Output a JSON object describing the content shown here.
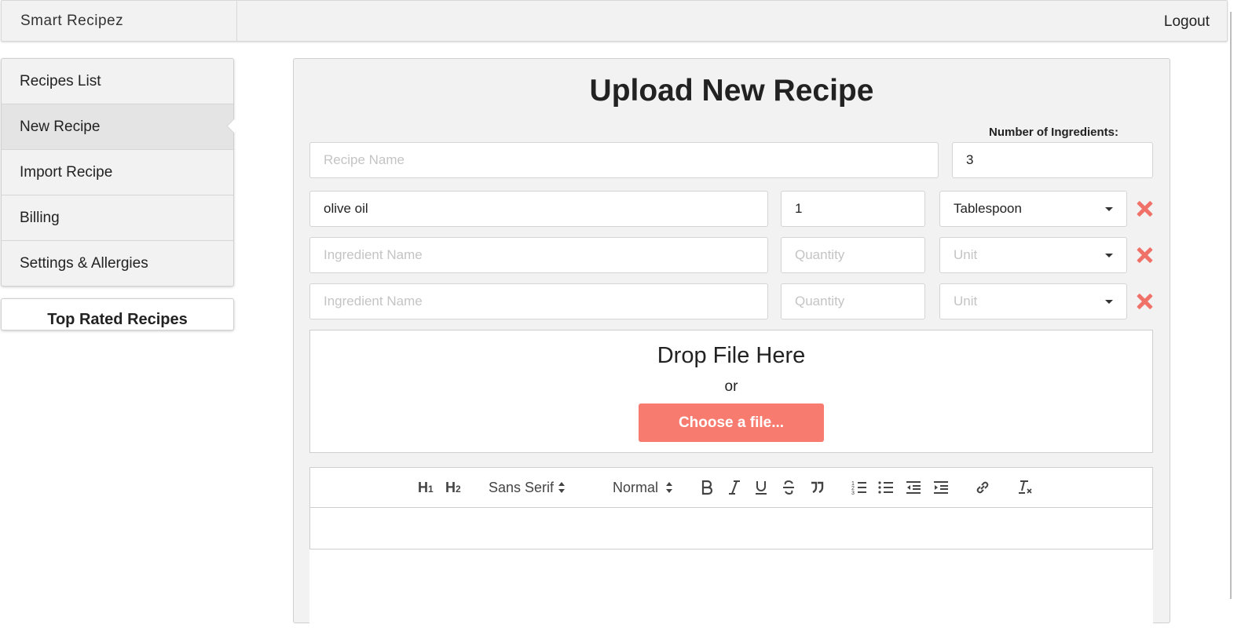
{
  "header": {
    "brand": "Smart Recipez",
    "logout_label": "Logout"
  },
  "sidebar": {
    "items": [
      {
        "label": "Recipes List"
      },
      {
        "label": "New Recipe"
      },
      {
        "label": "Import Recipe"
      },
      {
        "label": "Billing"
      },
      {
        "label": "Settings & Allergies"
      }
    ],
    "active_index": 1,
    "top_rated_label": "Top Rated Recipes"
  },
  "form": {
    "title": "Upload New Recipe",
    "num_ingredients_label": "Number of Ingredients:",
    "num_ingredients_value": "3",
    "recipe_name_placeholder": "Recipe Name",
    "ingredients": [
      {
        "name": "olive oil",
        "quantity": "1",
        "unit": "Tablespoon"
      },
      {
        "name": "Ingredient Name",
        "quantity": "Quantity",
        "unit": "Unit"
      },
      {
        "name": "Ingredient Name",
        "quantity": "Quantity",
        "unit": "Unit"
      }
    ]
  },
  "dropzone": {
    "title": "Drop File Here",
    "or": "or",
    "button_label": "Choose a file..."
  },
  "editor": {
    "toolbar": {
      "h1": "H1",
      "h2": "H2",
      "font_select": "Sans Serif",
      "size_select": "Normal"
    }
  },
  "colors": {
    "accent": "#f87b70",
    "remove_icon": "#f07168",
    "panel_bg": "#f2f2f2"
  }
}
